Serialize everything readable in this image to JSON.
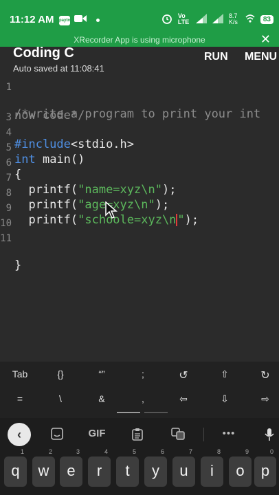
{
  "status": {
    "time": "11:12 AM",
    "paytm_label": "paytm",
    "volte": "Vo LTE",
    "net_speed": "8.7 K/s",
    "battery": "83"
  },
  "recording_notice": "XRecorder App is using microphone",
  "header": {
    "title": "Coding C",
    "subtitle": "Auto saved at 11:08:41",
    "run_label": "RUN",
    "menu_label": "MENU"
  },
  "editor": {
    "line_numbers": [
      "1",
      "",
      "3",
      "4",
      "5",
      "6",
      "7",
      "8",
      "9",
      "10",
      "11"
    ],
    "l1": "/*write a program to print your int",
    "l2": "now code*/",
    "l3_kw": "#include",
    "l3_rest": "<stdio.h>",
    "l4_kw": "int",
    "l4_rest": " main()",
    "l5": "{",
    "l6_a": "  printf(",
    "l6_s": "\"name=xyz\\n\"",
    "l6_b": ");",
    "l7_a": "  printf(",
    "l7_s": "\"age=xyz\\n\"",
    "l7_b": ");",
    "l8_a": "  printf(",
    "l8_s": "\"schoole=xyz\\n",
    "l8_s2": "\"",
    "l8_b": ");",
    "l11": "}"
  },
  "symbols": {
    "row1": [
      "Tab",
      "{}",
      "“”",
      ";",
      "↺",
      "⇧",
      "↻"
    ],
    "row2": [
      "=",
      "\\",
      "&",
      ",",
      "⇦",
      "⇩",
      "⇨"
    ]
  },
  "keyboard": {
    "gif_label": "GIF",
    "more": "•••",
    "keys": [
      "q",
      "w",
      "e",
      "r",
      "t",
      "y",
      "u",
      "i",
      "o",
      "p"
    ],
    "nums": [
      "1",
      "2",
      "3",
      "4",
      "5",
      "6",
      "7",
      "8",
      "9",
      "0"
    ]
  }
}
